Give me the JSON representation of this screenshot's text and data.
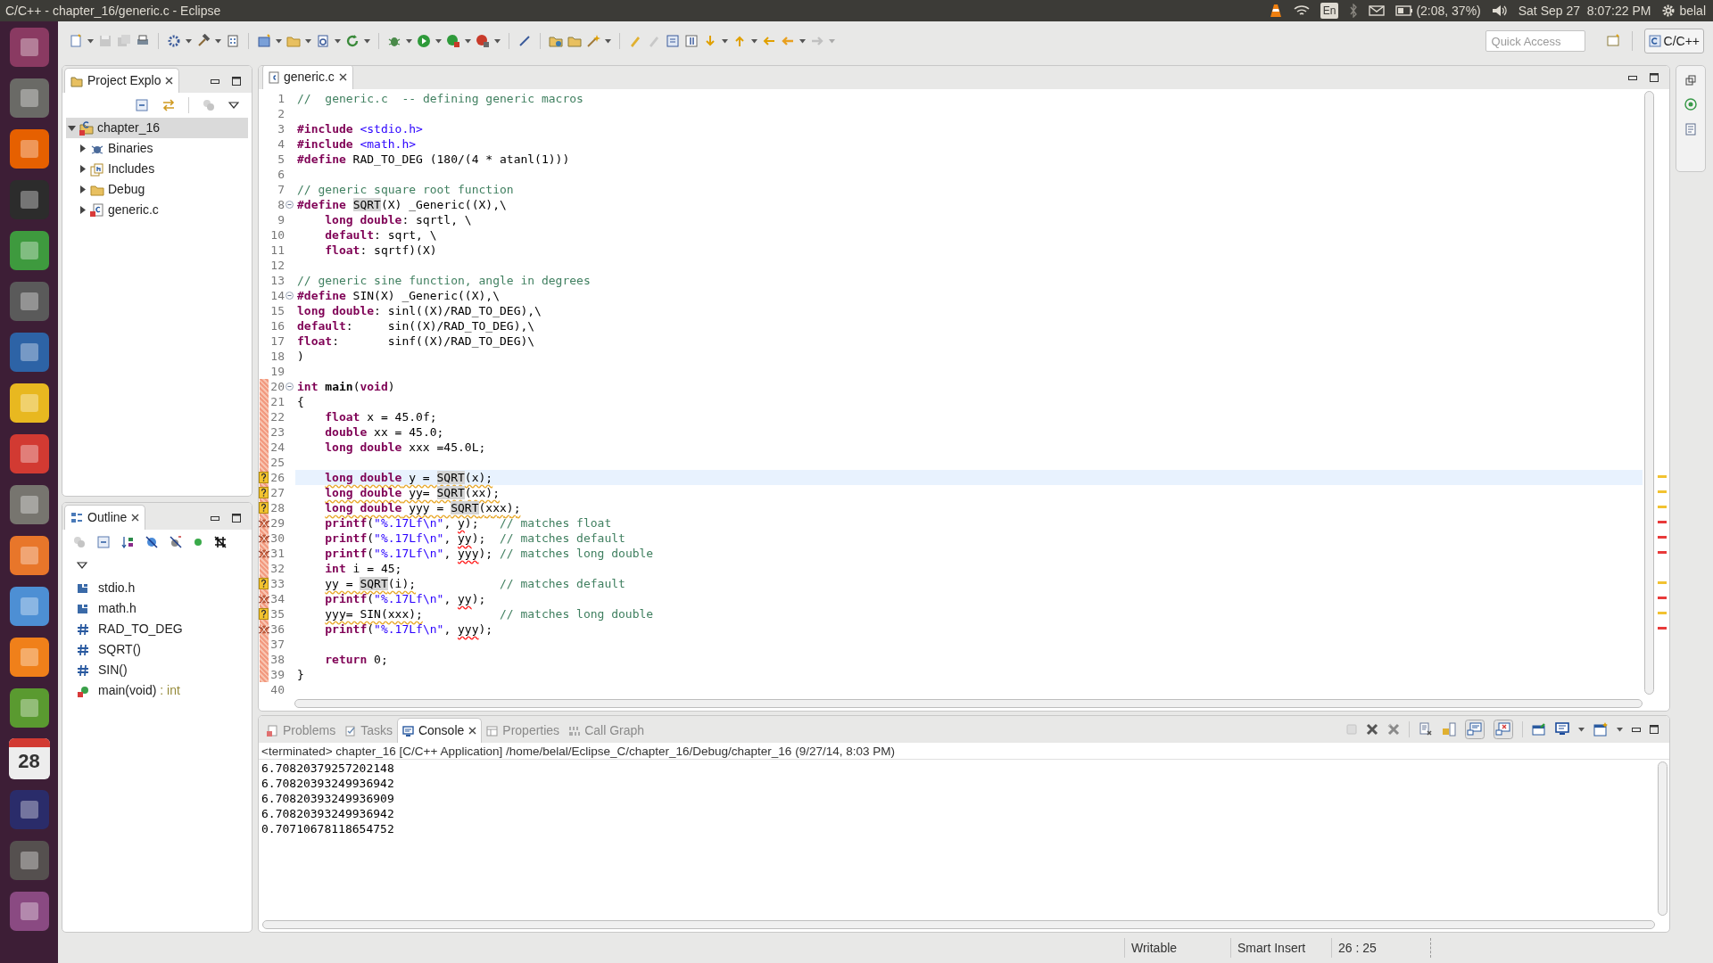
{
  "system_bar": {
    "title": "C/C++ - chapter_16/generic.c - Eclipse",
    "keyboard": "En",
    "battery": "(2:08, 37%)",
    "clock": "Sat Sep 27  8:07:22 PM",
    "user": "belal"
  },
  "launcher": {
    "calendar_day": "28"
  },
  "toolbar": {
    "quick_access": {
      "placeholder": "Quick Access"
    },
    "perspective": "C/C++"
  },
  "project_explorer": {
    "title": "Project Explo",
    "tree": [
      {
        "label": "chapter_16",
        "kind": "project",
        "expanded": true,
        "selected": true,
        "children": [
          {
            "label": "Binaries",
            "kind": "binaries",
            "expanded": false,
            "selected": false
          },
          {
            "label": "Includes",
            "kind": "includes",
            "expanded": false,
            "selected": false
          },
          {
            "label": "Debug",
            "kind": "folder",
            "expanded": false,
            "selected": false
          },
          {
            "label": "generic.c",
            "kind": "source",
            "expanded": false,
            "selected": false
          }
        ]
      }
    ]
  },
  "outline": {
    "title": "Outline",
    "items": [
      {
        "label": "stdio.h",
        "kind": "include"
      },
      {
        "label": "math.h",
        "kind": "include"
      },
      {
        "label": "RAD_TO_DEG",
        "kind": "macro"
      },
      {
        "label": "SQRT()",
        "kind": "macro"
      },
      {
        "label": "SIN()",
        "kind": "macro"
      },
      {
        "label": "main(void)",
        "kind": "function",
        "type": " : int"
      }
    ]
  },
  "editor": {
    "tab": "generic.c",
    "lines": [
      {
        "number": "1",
        "kind": "plain",
        "range": false,
        "fold": false,
        "current": false,
        "indented": false,
        "tokens": [
          {
            "kind": "comment",
            "text": "//  generic.c  -- defining generic macros"
          }
        ]
      },
      {
        "number": "2",
        "kind": "plain",
        "range": false,
        "fold": false,
        "current": false
      },
      {
        "number": "3",
        "kind": "plain",
        "range": false,
        "fold": false,
        "current": false,
        "indented": false,
        "tokens": [
          {
            "kind": "keyword",
            "text": "#include"
          },
          {
            "kind": "header",
            "text": " <stdio.h>"
          }
        ]
      },
      {
        "number": "4",
        "kind": "plain",
        "range": false,
        "fold": false,
        "current": false,
        "indented": false,
        "tokens": [
          {
            "kind": "keyword",
            "text": "#include"
          },
          {
            "kind": "header",
            "text": " <math.h>"
          }
        ]
      },
      {
        "number": "5",
        "kind": "plain",
        "range": false,
        "fold": false,
        "current": false,
        "indented": false,
        "tokens": [
          {
            "kind": "keyword",
            "text": "#define"
          },
          {
            "kind": "plain",
            "text": " RAD_TO_DEG (180/(4 * atanl(1)))"
          }
        ]
      },
      {
        "number": "6",
        "kind": "plain",
        "range": false,
        "fold": false,
        "current": false
      },
      {
        "number": "7",
        "kind": "plain",
        "range": false,
        "fold": false,
        "current": false,
        "indented": false,
        "tokens": [
          {
            "kind": "comment",
            "text": "// generic square root function"
          }
        ]
      },
      {
        "number": "8",
        "kind": "plain",
        "range": false,
        "fold": true,
        "current": false,
        "indented": false,
        "tokens": [
          {
            "kind": "keyword",
            "text": "#define "
          },
          {
            "kind": "macro",
            "text": "SQRT"
          },
          {
            "kind": "plain",
            "text": "(X) _Generic((X),\\"
          }
        ]
      },
      {
        "number": "9",
        "kind": "plain",
        "range": false,
        "fold": false,
        "current": false,
        "indented": true,
        "tokens": [
          {
            "kind": "keyword",
            "text": "long double"
          },
          {
            "kind": "plain",
            "text": ": sqrtl, \\"
          }
        ]
      },
      {
        "number": "10",
        "kind": "plain",
        "range": false,
        "fold": false,
        "current": false,
        "indented": true,
        "tokens": [
          {
            "kind": "keyword",
            "text": "default"
          },
          {
            "kind": "plain",
            "text": ": sqrt, \\"
          }
        ]
      },
      {
        "number": "11",
        "kind": "plain",
        "range": false,
        "fold": false,
        "current": false,
        "indented": true,
        "tokens": [
          {
            "kind": "keyword",
            "text": "float"
          },
          {
            "kind": "plain",
            "text": ": sqrtf)(X)"
          }
        ]
      },
      {
        "number": "12",
        "kind": "plain",
        "range": false,
        "fold": false,
        "current": false
      },
      {
        "number": "13",
        "kind": "plain",
        "range": false,
        "fold": false,
        "current": false,
        "indented": false,
        "tokens": [
          {
            "kind": "comment",
            "text": "// generic sine function, angle in degrees"
          }
        ]
      },
      {
        "number": "14",
        "kind": "plain",
        "range": false,
        "fold": true,
        "current": false,
        "indented": false,
        "tokens": [
          {
            "kind": "keyword",
            "text": "#define"
          },
          {
            "kind": "plain",
            "text": " SIN(X) _Generic((X),\\"
          }
        ]
      },
      {
        "number": "15",
        "kind": "plain",
        "range": false,
        "fold": false,
        "current": false,
        "indented": false,
        "tokens": [
          {
            "kind": "keyword",
            "text": "long double"
          },
          {
            "kind": "plain",
            "text": ": sinl((X)/RAD_TO_DEG),\\"
          }
        ]
      },
      {
        "number": "16",
        "kind": "plain",
        "range": false,
        "fold": false,
        "current": false,
        "indented": false,
        "tokens": [
          {
            "kind": "keyword",
            "text": "default"
          },
          {
            "kind": "plain",
            "text": ":     sin((X)/RAD_TO_DEG),\\"
          }
        ]
      },
      {
        "number": "17",
        "kind": "plain",
        "range": false,
        "fold": false,
        "current": false,
        "indented": false,
        "tokens": [
          {
            "kind": "keyword",
            "text": "float"
          },
          {
            "kind": "plain",
            "text": ":       sinf((X)/RAD_TO_DEG)\\"
          }
        ]
      },
      {
        "number": "18",
        "kind": "plain",
        "range": false,
        "fold": false,
        "current": false,
        "indented": false,
        "tokens": [
          {
            "kind": "plain",
            "text": ")"
          }
        ]
      },
      {
        "number": "19",
        "kind": "plain",
        "range": false,
        "fold": false,
        "current": false
      },
      {
        "number": "20",
        "kind": "plain",
        "range": true,
        "fold": true,
        "current": false,
        "indented": false,
        "tokens": [
          {
            "kind": "keyword",
            "text": "int"
          },
          {
            "kind": "function",
            "text": " main"
          },
          {
            "kind": "plain",
            "text": "("
          },
          {
            "kind": "keyword",
            "text": "void"
          },
          {
            "kind": "plain",
            "text": ")"
          }
        ]
      },
      {
        "number": "21",
        "kind": "plain",
        "range": true,
        "fold": false,
        "current": false,
        "indented": false,
        "tokens": [
          {
            "kind": "plain",
            "text": "{"
          }
        ]
      },
      {
        "number": "22",
        "kind": "plain",
        "range": true,
        "fold": false,
        "current": false,
        "indented": true,
        "tokens": [
          {
            "kind": "keyword",
            "text": "float"
          },
          {
            "kind": "plain",
            "text": " x = 45.0f;"
          }
        ]
      },
      {
        "number": "23",
        "kind": "plain",
        "range": true,
        "fold": false,
        "current": false,
        "indented": true,
        "tokens": [
          {
            "kind": "keyword",
            "text": "double"
          },
          {
            "kind": "plain",
            "text": " xx = 45.0;"
          }
        ]
      },
      {
        "number": "24",
        "kind": "plain",
        "range": true,
        "fold": false,
        "current": false,
        "indented": true,
        "tokens": [
          {
            "kind": "keyword",
            "text": "long double"
          },
          {
            "kind": "plain",
            "text": " xxx =45.0L;"
          }
        ]
      },
      {
        "number": "25",
        "kind": "plain",
        "range": true,
        "fold": false,
        "current": false
      },
      {
        "number": "26",
        "kind": "warning",
        "range": true,
        "fold": false,
        "current": true,
        "indented": true,
        "tokens": [
          {
            "kind": "keyword_warning",
            "text": "long double"
          },
          {
            "kind": "plain_warning",
            "text": " y = "
          },
          {
            "kind": "macro_warning",
            "text": "SQRT"
          },
          {
            "kind": "plain_warning",
            "text": "(x);"
          }
        ]
      },
      {
        "number": "27",
        "kind": "warning",
        "range": true,
        "fold": false,
        "current": false,
        "indented": true,
        "tokens": [
          {
            "kind": "keyword_warning",
            "text": "long double"
          },
          {
            "kind": "plain_warning",
            "text": " yy= "
          },
          {
            "kind": "macro_warning",
            "text": "SQRT"
          },
          {
            "kind": "plain_warning",
            "text": "(xx);"
          }
        ]
      },
      {
        "number": "28",
        "kind": "warning",
        "range": true,
        "fold": false,
        "current": false,
        "indented": true,
        "tokens": [
          {
            "kind": "keyword_warning",
            "text": "long double"
          },
          {
            "kind": "plain_warning",
            "text": " yyy = "
          },
          {
            "kind": "macro_warning",
            "text": "SQRT"
          },
          {
            "kind": "plain_warning",
            "text": "(xxx);"
          }
        ]
      },
      {
        "number": "29",
        "kind": "error",
        "range": true,
        "fold": false,
        "current": false,
        "indented": true,
        "tokens": [
          {
            "kind": "keyword",
            "text": "printf"
          },
          {
            "kind": "plain",
            "text": "("
          },
          {
            "kind": "string",
            "text": "\"%.17Lf\\n\""
          },
          {
            "kind": "plain",
            "text": ", "
          },
          {
            "kind": "plain_error",
            "text": "y"
          },
          {
            "kind": "plain",
            "text": ");"
          },
          {
            "kind": "comment",
            "text": "   // matches float"
          }
        ]
      },
      {
        "number": "30",
        "kind": "error",
        "range": true,
        "fold": false,
        "current": false,
        "indented": true,
        "tokens": [
          {
            "kind": "keyword",
            "text": "printf"
          },
          {
            "kind": "plain",
            "text": "("
          },
          {
            "kind": "string",
            "text": "\"%.17Lf\\n\""
          },
          {
            "kind": "plain",
            "text": ", "
          },
          {
            "kind": "plain_error",
            "text": "yy"
          },
          {
            "kind": "plain",
            "text": ");"
          },
          {
            "kind": "comment",
            "text": "  // matches default"
          }
        ]
      },
      {
        "number": "31",
        "kind": "error",
        "range": true,
        "fold": false,
        "current": false,
        "indented": true,
        "tokens": [
          {
            "kind": "keyword",
            "text": "printf"
          },
          {
            "kind": "plain",
            "text": "("
          },
          {
            "kind": "string",
            "text": "\"%.17Lf\\n\""
          },
          {
            "kind": "plain",
            "text": ", "
          },
          {
            "kind": "plain_error",
            "text": "yyy"
          },
          {
            "kind": "plain",
            "text": ");"
          },
          {
            "kind": "comment",
            "text": " // matches long double"
          }
        ]
      },
      {
        "number": "32",
        "kind": "plain",
        "range": true,
        "fold": false,
        "current": false,
        "indented": true,
        "tokens": [
          {
            "kind": "keyword",
            "text": "int"
          },
          {
            "kind": "plain",
            "text": " i = 45;"
          }
        ]
      },
      {
        "number": "33",
        "kind": "warning",
        "range": true,
        "fold": false,
        "current": false,
        "indented": true,
        "tokens": [
          {
            "kind": "plain_warning",
            "text": "yy = "
          },
          {
            "kind": "macro_warning",
            "text": "SQRT"
          },
          {
            "kind": "plain_warning",
            "text": "(i);"
          },
          {
            "kind": "comment",
            "text": "            // matches default"
          }
        ]
      },
      {
        "number": "34",
        "kind": "error",
        "range": true,
        "fold": false,
        "current": false,
        "indented": true,
        "tokens": [
          {
            "kind": "keyword",
            "text": "printf"
          },
          {
            "kind": "plain",
            "text": "("
          },
          {
            "kind": "string",
            "text": "\"%.17Lf\\n\""
          },
          {
            "kind": "plain",
            "text": ", "
          },
          {
            "kind": "plain_error",
            "text": "yy"
          },
          {
            "kind": "plain",
            "text": ");"
          }
        ]
      },
      {
        "number": "35",
        "kind": "warning",
        "range": true,
        "fold": false,
        "current": false,
        "indented": true,
        "tokens": [
          {
            "kind": "plain_warning",
            "text": "yyy= SIN(xxx);"
          },
          {
            "kind": "comment",
            "text": "           // matches long double"
          }
        ]
      },
      {
        "number": "36",
        "kind": "error",
        "range": true,
        "fold": false,
        "current": false,
        "indented": true,
        "tokens": [
          {
            "kind": "keyword",
            "text": "printf"
          },
          {
            "kind": "plain",
            "text": "("
          },
          {
            "kind": "string",
            "text": "\"%.17Lf\\n\""
          },
          {
            "kind": "plain",
            "text": ", "
          },
          {
            "kind": "plain_error",
            "text": "yyy"
          },
          {
            "kind": "plain",
            "text": ");"
          }
        ]
      },
      {
        "number": "37",
        "kind": "plain",
        "range": true,
        "fold": false,
        "current": false
      },
      {
        "number": "38",
        "kind": "plain",
        "range": true,
        "fold": false,
        "current": false,
        "indented": true,
        "tokens": [
          {
            "kind": "keyword",
            "text": "return"
          },
          {
            "kind": "plain",
            "text": " 0;"
          }
        ]
      },
      {
        "number": "39",
        "kind": "plain",
        "range": true,
        "fold": false,
        "current": false,
        "indented": false,
        "tokens": [
          {
            "kind": "plain",
            "text": "}"
          }
        ]
      },
      {
        "number": "40",
        "kind": "plain",
        "range": false,
        "fold": false,
        "current": false
      }
    ]
  },
  "console_panel": {
    "tabs": [
      {
        "label": "Problems",
        "kind": "problems",
        "selected": false
      },
      {
        "label": "Tasks",
        "kind": "tasks",
        "selected": false
      },
      {
        "label": "Console",
        "kind": "console",
        "selected": true
      },
      {
        "label": "Properties",
        "kind": "properties",
        "selected": false
      },
      {
        "label": "Call Graph",
        "kind": "callgraph",
        "selected": false
      }
    ],
    "header": "<terminated> chapter_16 [C/C++ Application] /home/belal/Eclipse_C/chapter_16/Debug/chapter_16 (9/27/14, 8:03 PM)",
    "output": [
      "6.70820379257202148",
      "6.70820393249936942",
      "6.70820393249936909",
      "6.70820393249936942",
      "0.70710678118654752"
    ]
  },
  "status_bar": {
    "mode": "Writable",
    "insert": "Smart Insert",
    "position": "26 : 25"
  }
}
